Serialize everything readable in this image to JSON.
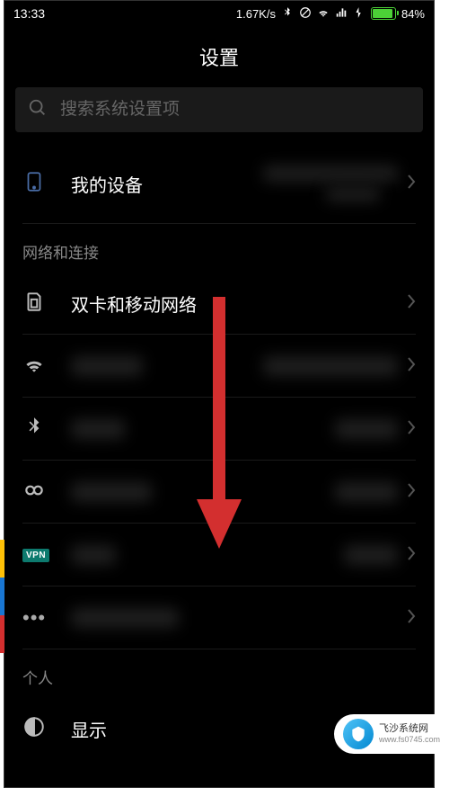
{
  "status_bar": {
    "time": "13:33",
    "network_speed": "1.67K/s",
    "battery_percent": "84%"
  },
  "page_title": "设置",
  "search": {
    "placeholder": "搜索系统设置项"
  },
  "device": {
    "label": "我的设备"
  },
  "sections": {
    "network": "网络和连接",
    "personal": "个人"
  },
  "items": {
    "sim": "双卡和移动网络",
    "display": "显示"
  },
  "watermark": {
    "title": "飞沙系统网",
    "url": "www.fs0745.com"
  }
}
